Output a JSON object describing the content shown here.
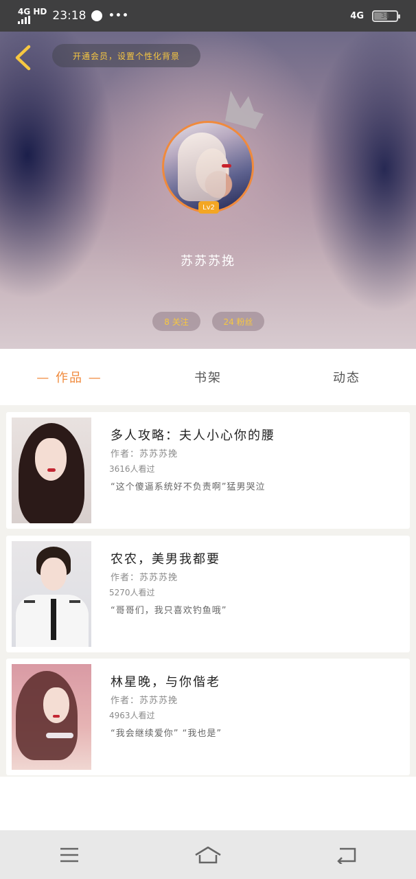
{
  "status_bar": {
    "network": "4G HD",
    "time": "23:18",
    "dots": "•••",
    "network_right": "4G",
    "battery": "38"
  },
  "header": {
    "vip_banner": "开通会员，设置个性化背景",
    "level": "Lv2",
    "username": "苏苏苏挽",
    "following": "8 关注",
    "fans": "24 粉丝"
  },
  "tabs": [
    {
      "label": "— 作品 —",
      "active": true
    },
    {
      "label": "书架",
      "active": false
    },
    {
      "label": "动态",
      "active": false
    }
  ],
  "books": [
    {
      "title": "多人攻略：夫人小心你的腰",
      "author": "作者：苏苏苏挽",
      "views": "3616人看过",
      "quote": "“这个傻逼系统好不负责啊”猛男哭泣"
    },
    {
      "title": "农农，美男我都要",
      "author": "作者：苏苏苏挽",
      "views": "5270人看过",
      "quote": "“哥哥们，我只喜欢钓鱼哦”"
    },
    {
      "title": "林星晚，与你偕老",
      "author": "作者：苏苏苏挽",
      "views": "4963人看过",
      "quote": "“我会继续爱你” “我也是”"
    }
  ],
  "colors": {
    "accent": "#f08a3c",
    "vip_text": "#f7c741",
    "status_bar": "#3f3f40"
  },
  "icons": {
    "back": "chevron-left-icon",
    "crown": "crown-icon",
    "nav_menu": "menu-icon",
    "nav_home": "home-icon",
    "nav_back": "return-icon"
  }
}
